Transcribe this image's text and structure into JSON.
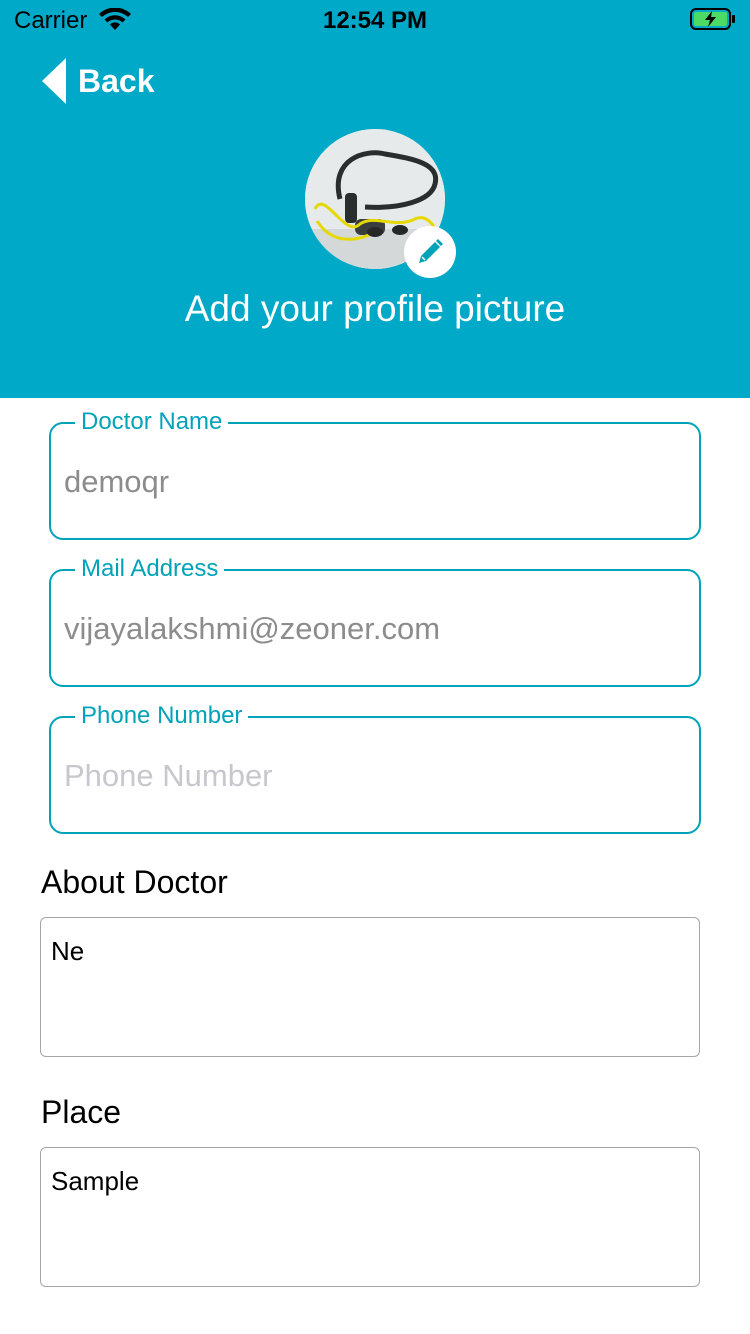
{
  "status_bar": {
    "carrier": "Carrier",
    "time": "12:54 PM"
  },
  "nav": {
    "back_label": "Back"
  },
  "profile": {
    "title": "Add your profile picture"
  },
  "form": {
    "doctor_name": {
      "label": "Doctor Name",
      "value": "demoqr"
    },
    "mail_address": {
      "label": "Mail Address",
      "value": "vijayalakshmi@zeoner.com"
    },
    "phone_number": {
      "label": "Phone Number",
      "value": "",
      "placeholder": "Phone Number"
    },
    "about": {
      "label": "About Doctor",
      "value": "Ne"
    },
    "place": {
      "label": "Place",
      "value": "Sample"
    }
  },
  "colors": {
    "header": "#00a9c8",
    "accent": "#00a3b8"
  },
  "icons": [
    "wifi-icon",
    "battery-charging-icon",
    "back-chevron-icon",
    "pencil-icon"
  ]
}
